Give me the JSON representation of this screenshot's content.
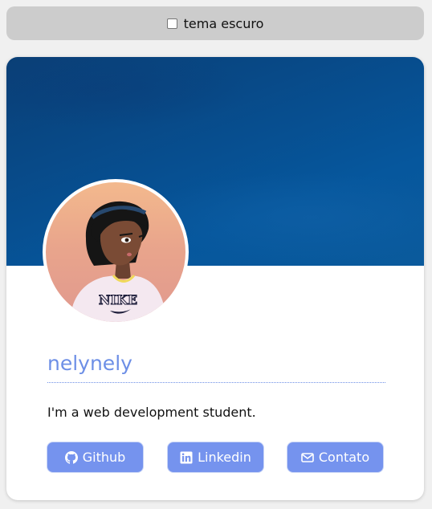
{
  "theme_toggle": {
    "label": "tema escuro",
    "checked": false
  },
  "profile": {
    "username": "nelynely",
    "bio": "I'm a web development student.",
    "avatar_shirt_text": "NIKE"
  },
  "links": [
    {
      "label": "Github",
      "icon": "github-icon"
    },
    {
      "label": "Linkedin",
      "icon": "linkedin-icon"
    },
    {
      "label": "Contato",
      "icon": "envelope-icon"
    }
  ],
  "colors": {
    "accent": "#7593ee",
    "username": "#6d8fe6",
    "cover": "#074e8f"
  }
}
